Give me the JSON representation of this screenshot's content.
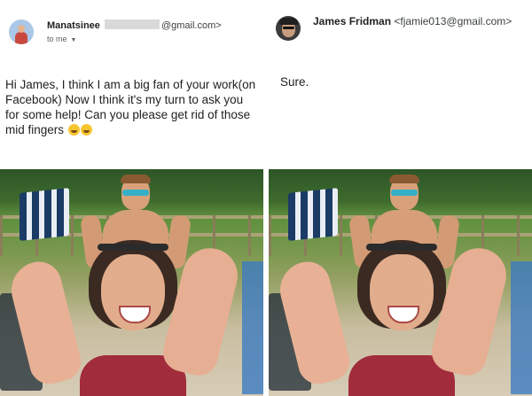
{
  "left": {
    "sender_name": "Manatsinee",
    "sender_email_suffix": "@gmail.com>",
    "to_line": "to me",
    "caret_icon": "dropdown-caret-icon",
    "message": "Hi James, I think I am a big fan of your work(on Facebook) Now I think it's my turn to ask you for some help! Can you please get rid of those mid fingers",
    "emojis": [
      "smiling-face-emoji",
      "winking-face-emoji"
    ]
  },
  "right": {
    "sender_name": "James Fridman",
    "sender_email": "<fjamie013@gmail.com>",
    "message": "Sure."
  },
  "colors": {
    "emoji_yellow": "#f7c52f",
    "text": "#202124",
    "muted": "#5f6368"
  }
}
